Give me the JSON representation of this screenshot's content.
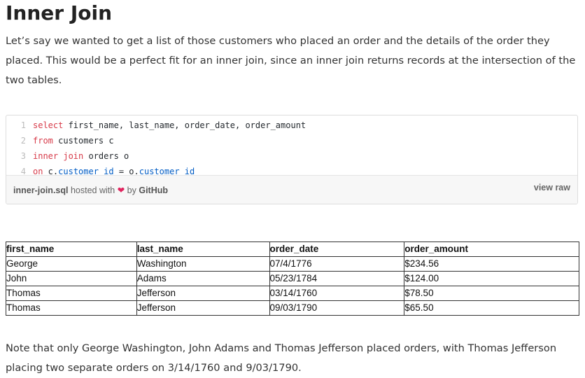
{
  "article": {
    "title": "Inner Join",
    "intro": "Let’s say we wanted to get a list of those customers who placed an order and the details of the order they placed. This would be a perfect fit for an inner join, since an inner join returns records at the intersection of the two tables.",
    "note": "Note that only George Washington, John Adams and Thomas Jefferson placed orders, with Thomas Jefferson placing two separate orders on 3/14/1760 and 9/03/1790."
  },
  "gist": {
    "lines": [
      {
        "num": "1",
        "parts": [
          {
            "t": "select",
            "c": "kw"
          },
          {
            "t": " first_name, last_name, order_date, order_amount",
            "c": "tx"
          }
        ]
      },
      {
        "num": "2",
        "parts": [
          {
            "t": "from",
            "c": "kw"
          },
          {
            "t": " customers c",
            "c": "tx"
          }
        ]
      },
      {
        "num": "3",
        "parts": [
          {
            "t": "inner join",
            "c": "kw"
          },
          {
            "t": " orders o",
            "c": "tx"
          }
        ]
      },
      {
        "num": "4",
        "parts": [
          {
            "t": "on",
            "c": "kw"
          },
          {
            "t": " c.",
            "c": "tx"
          },
          {
            "t": "customer_id",
            "c": "bl"
          },
          {
            "t": " = o.",
            "c": "tx"
          },
          {
            "t": "customer_id",
            "c": "bl"
          }
        ]
      }
    ],
    "filename": "inner-join.sql",
    "hosted_with": "hosted with",
    "heart": "❤",
    "by": "by",
    "host": "GitHub",
    "view_raw": "view raw"
  },
  "table": {
    "headers": [
      "first_name",
      "last_name",
      "order_date",
      "order_amount"
    ],
    "rows": [
      [
        "George",
        "Washington",
        "07/4/1776",
        "$234.56"
      ],
      [
        "John",
        "Adams",
        "05/23/1784",
        "$124.00"
      ],
      [
        "Thomas",
        "Jefferson",
        "03/14/1760",
        "$78.50"
      ],
      [
        "Thomas",
        "Jefferson",
        "09/03/1790",
        "$65.50"
      ]
    ]
  },
  "colors": {
    "keyword": "#d73a49",
    "identifier": "#005cc5",
    "heart": "#e0245e"
  }
}
